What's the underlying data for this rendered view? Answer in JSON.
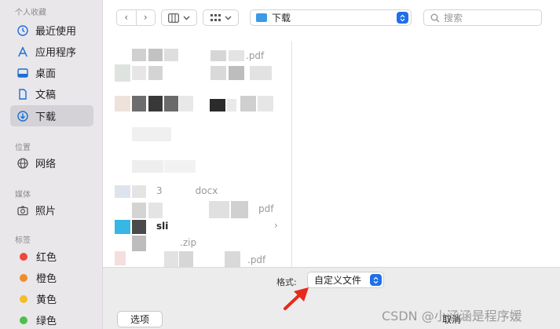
{
  "sidebar": {
    "sections": [
      {
        "title": "个人收藏",
        "items": [
          {
            "label": "最近使用",
            "icon": "clock-icon",
            "selected": false
          },
          {
            "label": "应用程序",
            "icon": "apps-icon",
            "selected": false
          },
          {
            "label": "桌面",
            "icon": "desktop-icon",
            "selected": false
          },
          {
            "label": "文稿",
            "icon": "document-icon",
            "selected": false
          },
          {
            "label": "下载",
            "icon": "download-icon",
            "selected": true
          }
        ]
      },
      {
        "title": "位置",
        "items": [
          {
            "label": "网络",
            "icon": "network-icon",
            "selected": false
          }
        ]
      },
      {
        "title": "媒体",
        "items": [
          {
            "label": "照片",
            "icon": "camera-icon",
            "selected": false
          }
        ]
      },
      {
        "title": "标签",
        "items": [
          {
            "label": "红色",
            "color": "#f0463c"
          },
          {
            "label": "橙色",
            "color": "#f08c2a"
          },
          {
            "label": "黄色",
            "color": "#f2be2c"
          },
          {
            "label": "绿色",
            "color": "#4cc04a"
          }
        ]
      }
    ]
  },
  "toolbar": {
    "back_glyph": "‹",
    "forward_glyph": "›",
    "location": "下载",
    "search_placeholder": "搜索"
  },
  "files": [
    {
      "name": "pdf",
      "prefix": "",
      "suffix_visible": ".pdf"
    },
    {
      "name": "",
      "suffix_visible": ""
    },
    {
      "name": "",
      "suffix_visible": ""
    },
    {
      "name": "",
      "suffix_visible": ""
    },
    {
      "name": "docx",
      "prefix": "3",
      "suffix_visible": "docx"
    },
    {
      "name": "pdf",
      "suffix_visible": "pdf"
    },
    {
      "name": "sli",
      "suffix_visible": "sli",
      "is_folder": true
    },
    {
      "name": "zip",
      "suffix_visible": ".zip"
    },
    {
      "name": "pdf",
      "suffix_visible": ".pdf"
    }
  ],
  "bottom": {
    "format_label": "格式:",
    "format_value": "自定义文件",
    "options_label": "选项",
    "cancel_label": "取消"
  },
  "watermark": "CSDN @小涵涵是程序媛",
  "colors": {
    "accent": "#1f6fe8",
    "folder": "#3d9ae8",
    "arrow": "#e8291c"
  }
}
